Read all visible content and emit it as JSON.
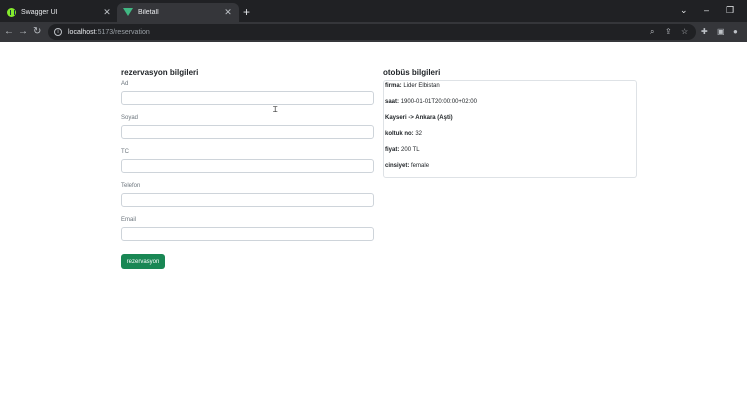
{
  "browser": {
    "tabs": [
      {
        "title": "Swagger UI",
        "icon": "swagger-icon",
        "active": false
      },
      {
        "title": "Biletall",
        "icon": "vue-icon",
        "active": true
      }
    ],
    "new_tab": "+",
    "url_host": "localhost",
    "url_path": ":5173/reservation"
  },
  "reservation": {
    "heading": "rezervasyon bilgileri",
    "fields": [
      {
        "label": "Ad",
        "value": ""
      },
      {
        "label": "Soyad",
        "value": ""
      },
      {
        "label": "TC",
        "value": ""
      },
      {
        "label": "Telefon",
        "value": ""
      },
      {
        "label": "Email",
        "value": ""
      }
    ],
    "submit_label": "rezervasyon"
  },
  "bus": {
    "heading": "otobüs bilgileri",
    "firma_label": "firma:",
    "firma_value": "Lider Elbistan",
    "saat_label": "saat:",
    "saat_value": "1900-01-01T20:00:00+02:00",
    "route": "Kayseri -> Ankara (Aşti)",
    "koltuk_label": "koltuk no:",
    "koltuk_value": "32",
    "fiyat_label": "fiyat:",
    "fiyat_value": "200 TL",
    "cinsiyet_label": "cinsiyet:",
    "cinsiyet_value": "female"
  },
  "colors": {
    "accent": "#198754",
    "chrome": "#35363a"
  }
}
